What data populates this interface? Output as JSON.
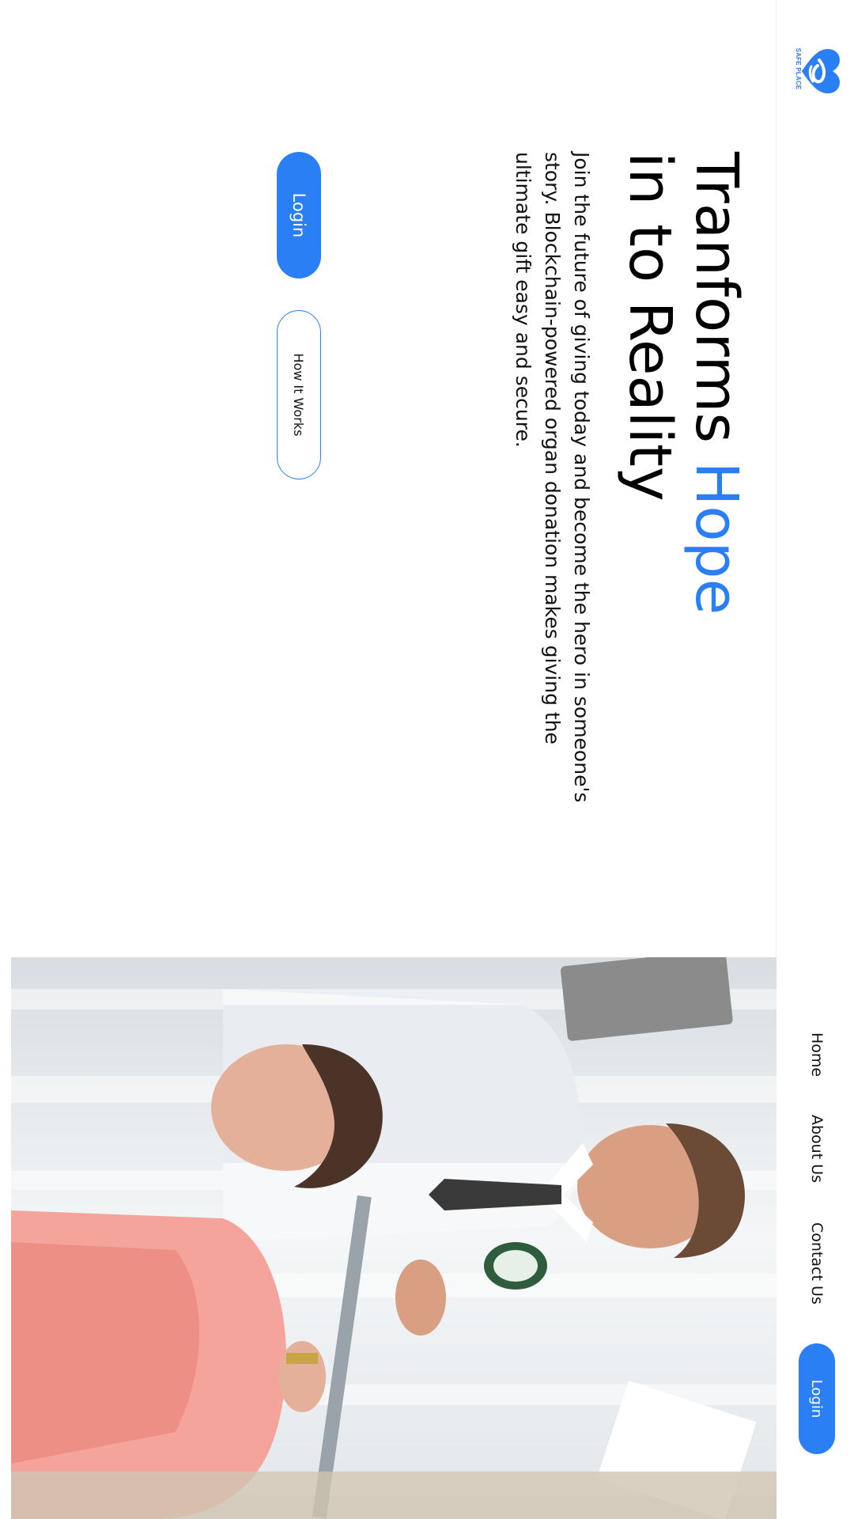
{
  "brand": {
    "logo_text": "SAFE PLACE",
    "accent_color": "#2a7ff5",
    "logo_icon": "heart-hand-icon"
  },
  "nav": {
    "links": [
      "Home",
      "About Us",
      "Contact Us"
    ],
    "login_label": "Login"
  },
  "hero": {
    "title_part1": "Tranforms ",
    "title_accent": "Hope",
    "title_line2": "in to Reality",
    "description": "Join the future of giving today and become the hero in someone's story. Blockchain-powered organ donation makes giving the ultimate gift easy and secure.",
    "login_label": "Login",
    "secondary_label": "How It Works",
    "image_subject": "doctor-with-patient-photo"
  }
}
